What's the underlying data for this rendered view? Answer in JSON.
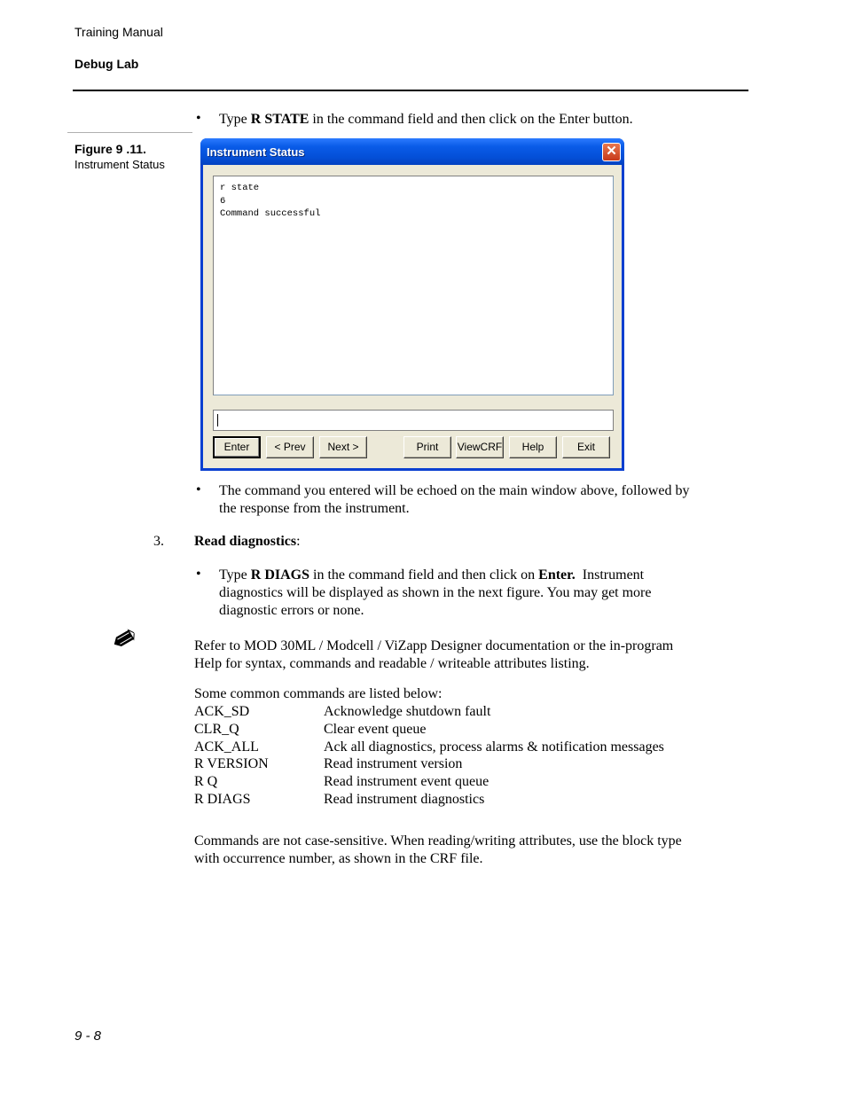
{
  "header": {
    "manual_title": "Training Manual",
    "section_title": "Debug Lab"
  },
  "figure": {
    "number": "Figure 9 .11.",
    "caption": "Instrument Status"
  },
  "bullets": {
    "type_rstate": {
      "pre": "Type ",
      "bold": "R STATE",
      "post": " in the command field and then click on the Enter button."
    },
    "echo": {
      "line1": "The command you entered will be echoed on the main window above, followed by",
      "line2": "the response from the instrument."
    },
    "type_rdiags": {
      "pre": "Type ",
      "bold1": "R DIAGS",
      "mid": " in the command field and then click on ",
      "bold2": "Enter.",
      "post": "  Instrument",
      "line2": "diagnostics will be displayed as shown in the next figure. You may get more",
      "line3": "diagnostic errors or none."
    }
  },
  "step3": {
    "number": "3.",
    "title": "Read diagnostics",
    "suffix": ":"
  },
  "window": {
    "title": "Instrument Status",
    "close_glyph": "✕",
    "output_lines": [
      "r state",
      "6",
      "Command successful"
    ],
    "command_value": "",
    "buttons": {
      "enter": "Enter",
      "prev": "< Prev",
      "next": "Next >",
      "print": "Print",
      "viewcrf": "ViewCRF",
      "help": "Help",
      "exit": "Exit"
    }
  },
  "note": {
    "icon": "pencil-icon",
    "line1": "Refer to MOD 30ML / Modcell / ViZapp Designer documentation or the in-program",
    "line2": "Help for syntax, commands and readable / writeable attributes listing.",
    "commands_intro": "Some common commands are listed below:",
    "commands": [
      {
        "name": "ACK_SD",
        "desc": "Acknowledge shutdown fault"
      },
      {
        "name": "CLR_Q",
        "desc": "Clear event queue"
      },
      {
        "name": "ACK_ALL",
        "desc": "Ack all diagnostics, process alarms & notification messages"
      },
      {
        "name": "R VERSION",
        "desc": "Read instrument version"
      },
      {
        "name": "R Q",
        "desc": "Read instrument event queue"
      },
      {
        "name": "R DIAGS",
        "desc": "Read instrument diagnostics"
      }
    ],
    "closing_line1": "Commands are not case-sensitive. When reading/writing attributes, use the block type",
    "closing_line2": "with occurrence number, as shown in the CRF file."
  },
  "footer": {
    "page_number": "9 - 8"
  }
}
